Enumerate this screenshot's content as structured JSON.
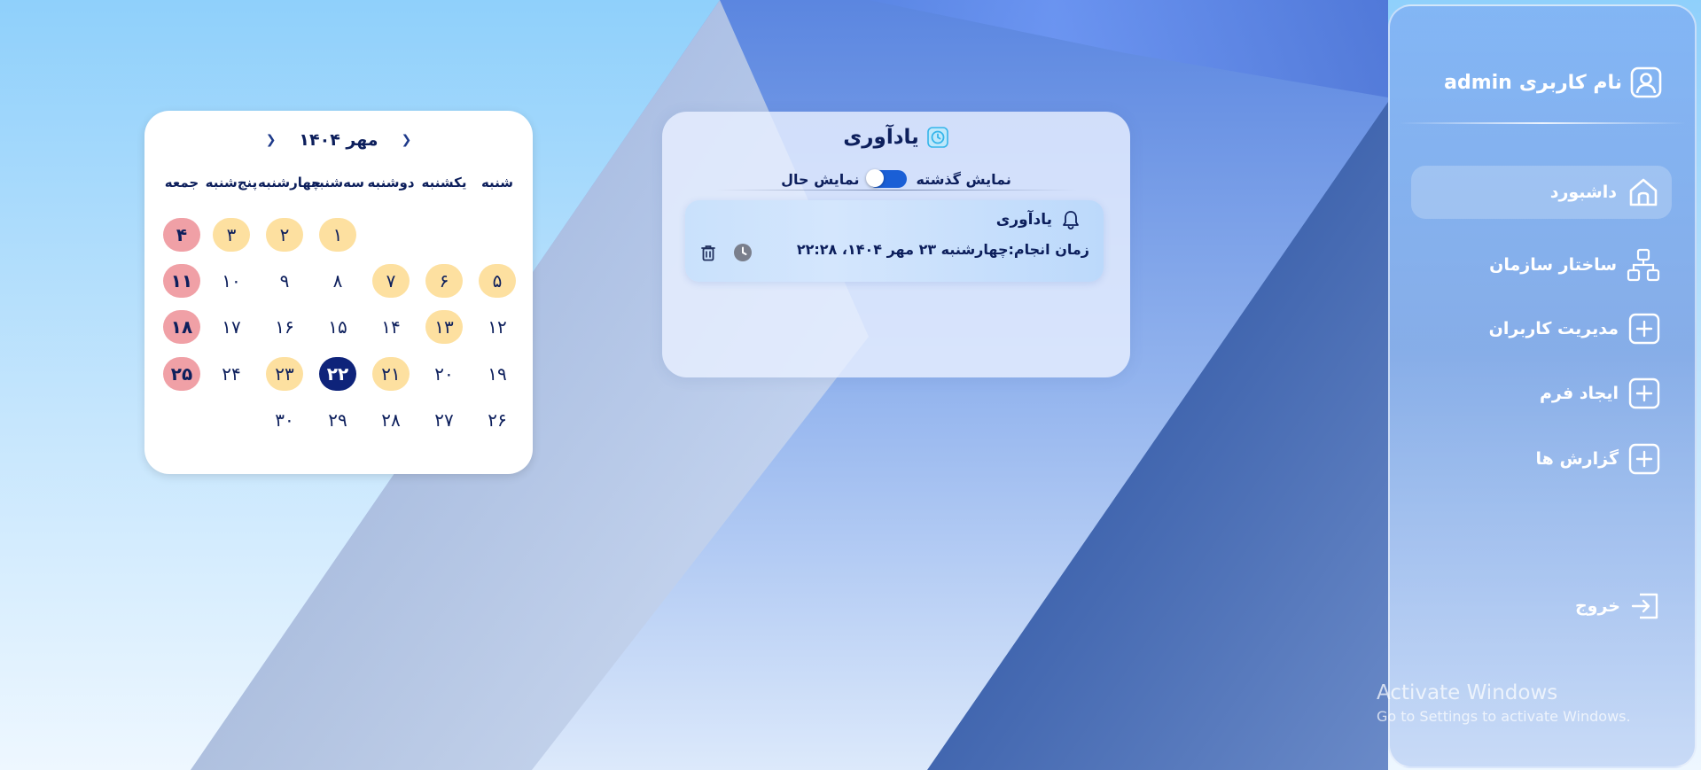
{
  "user": {
    "label": "نام کاربری",
    "name": "admin"
  },
  "sidebar": {
    "items": [
      {
        "label": "داشبورد",
        "icon": "home-icon",
        "active": true
      },
      {
        "label": "ساختار سازمان",
        "icon": "org-structure-icon"
      },
      {
        "label": "مدیریت کاربران",
        "icon": "plus-square-icon"
      },
      {
        "label": "ایجاد فرم",
        "icon": "plus-square-icon"
      },
      {
        "label": "گزارش ها",
        "icon": "plus-square-icon"
      }
    ],
    "logout": {
      "label": "خروج",
      "icon": "logout-icon"
    }
  },
  "watermark": {
    "title": "Activate Windows",
    "subtitle": "Go to Settings to activate Windows."
  },
  "reminder": {
    "title": "یادآوری",
    "toggle_past": "نمایش گذشته",
    "toggle_present": "نمایش حال",
    "items": [
      {
        "title": "یادآوری",
        "time": "زمان انجام:چهارشنبه ۲۳ مهر ۱۴۰۴، ۲۲:۲۸"
      }
    ]
  },
  "calendar": {
    "month_label": "مهر ۱۴۰۴",
    "weekdays": [
      "شنبه",
      "یکشنبه",
      "دوشنبه",
      "سه‌شنبه",
      "چهارشنبه",
      "پنج‌شنبه",
      "جمعه"
    ],
    "days": [
      {
        "n": "۱",
        "type": "event"
      },
      {
        "n": "۲",
        "type": "event"
      },
      {
        "n": "۳",
        "type": "event"
      },
      {
        "n": "۴",
        "type": "holiday"
      },
      {
        "n": "۵",
        "type": "event"
      },
      {
        "n": "۶",
        "type": "event"
      },
      {
        "n": "۷",
        "type": "event"
      },
      {
        "n": "۸",
        "type": ""
      },
      {
        "n": "۹",
        "type": ""
      },
      {
        "n": "۱۰",
        "type": ""
      },
      {
        "n": "۱۱",
        "type": "holiday"
      },
      {
        "n": "۱۲",
        "type": ""
      },
      {
        "n": "۱۳",
        "type": "event"
      },
      {
        "n": "۱۴",
        "type": ""
      },
      {
        "n": "۱۵",
        "type": ""
      },
      {
        "n": "۱۶",
        "type": ""
      },
      {
        "n": "۱۷",
        "type": ""
      },
      {
        "n": "۱۸",
        "type": "holiday"
      },
      {
        "n": "۱۹",
        "type": ""
      },
      {
        "n": "۲۰",
        "type": ""
      },
      {
        "n": "۲۱",
        "type": "event"
      },
      {
        "n": "۲۲",
        "type": "today"
      },
      {
        "n": "۲۳",
        "type": "event"
      },
      {
        "n": "۲۴",
        "type": ""
      },
      {
        "n": "۲۵",
        "type": "holiday"
      },
      {
        "n": "۲۶",
        "type": ""
      },
      {
        "n": "۲۷",
        "type": ""
      },
      {
        "n": "۲۸",
        "type": ""
      },
      {
        "n": "۲۹",
        "type": ""
      },
      {
        "n": "۳۰",
        "type": ""
      }
    ]
  },
  "colors": {
    "navy": "#0d1f5c",
    "today": "#0e237a",
    "event": "#fde0a0",
    "holiday": "#f0a0a6",
    "toggle": "#1a5fd6",
    "sidebar_text": "#ffffff"
  }
}
